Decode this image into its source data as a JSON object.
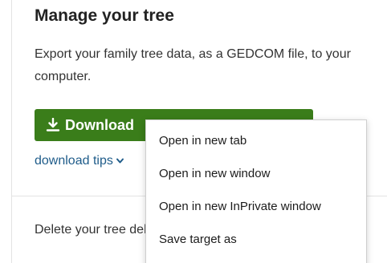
{
  "section": {
    "title": "Manage your tree",
    "description": "Export your family tree data, as a GEDCOM file, to your computer.",
    "download_button_label": "Download"
  },
  "tips": {
    "label": "download tips"
  },
  "delete_section": {
    "text": "Delete your tree deleting all peop"
  },
  "context_menu": {
    "items": [
      "Open in new tab",
      "Open in new window",
      "Open in new InPrivate window",
      "Save target as"
    ]
  },
  "colors": {
    "button_bg": "#3a7d1a",
    "link": "#1f5c8a"
  },
  "icons": {
    "download": "download-icon",
    "chevron": "chevron-down-icon"
  }
}
